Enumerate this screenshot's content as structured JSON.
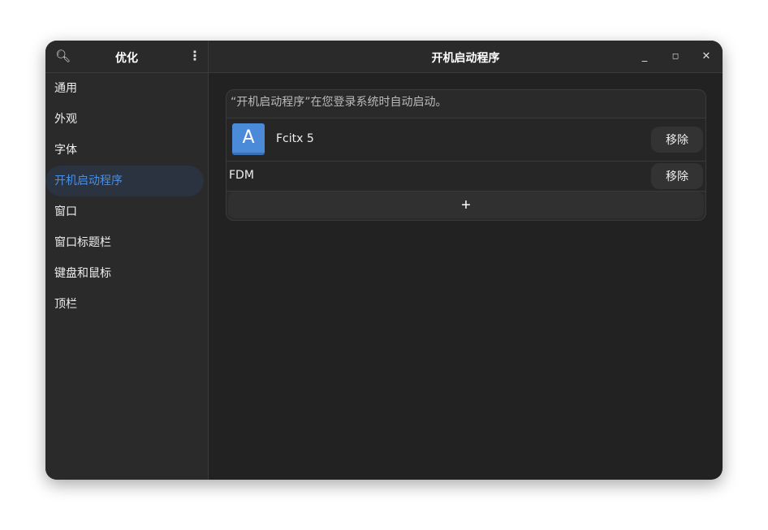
{
  "sidebar": {
    "title": "优化",
    "items": [
      {
        "label": "通用"
      },
      {
        "label": "外观"
      },
      {
        "label": "字体"
      },
      {
        "label": "开机启动程序"
      },
      {
        "label": "窗口"
      },
      {
        "label": "窗口标题栏"
      },
      {
        "label": "键盘和鼠标"
      },
      {
        "label": "顶栏"
      }
    ],
    "selected": "开机启动程序"
  },
  "header": {
    "title": "开机启动程序"
  },
  "main": {
    "description": "“开机启动程序”在您登录系统时自动启动。",
    "apps": [
      {
        "name": "Fcitx 5",
        "icon_letter": "A",
        "remove_label": "移除"
      },
      {
        "name": "FDM",
        "remove_label": "移除"
      }
    ],
    "add_label": "+"
  },
  "colors": {
    "accent": "#4a90e2",
    "icon": "#4a8ad8"
  }
}
